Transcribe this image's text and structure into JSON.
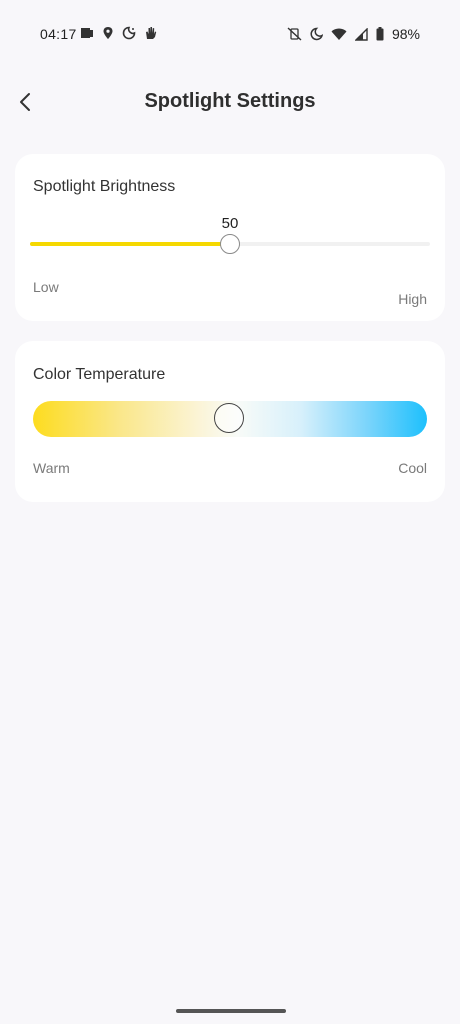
{
  "status_bar": {
    "time": "04:17",
    "battery_text": "98%",
    "left_icons": [
      "screen-cast-icon",
      "location-icon",
      "bedtime-icon",
      "hand-icon"
    ],
    "right_icons": [
      "vibrate-off-icon",
      "moon-icon",
      "wifi-icon",
      "signal-icon",
      "battery-icon"
    ]
  },
  "header": {
    "title": "Spotlight Settings",
    "back_icon": "chevron-left-icon"
  },
  "brightness": {
    "title": "Spotlight Brightness",
    "value": "50",
    "level_percent": 50,
    "low_label": "Low",
    "high_label": "High",
    "accent_color": "#f5d800"
  },
  "color_temperature": {
    "title": "Color Temperature",
    "warm_label": "Warm",
    "cool_label": "Cool",
    "position_percent": 50,
    "warm_color": "#fddc1f",
    "cool_color": "#1ec0fc"
  }
}
